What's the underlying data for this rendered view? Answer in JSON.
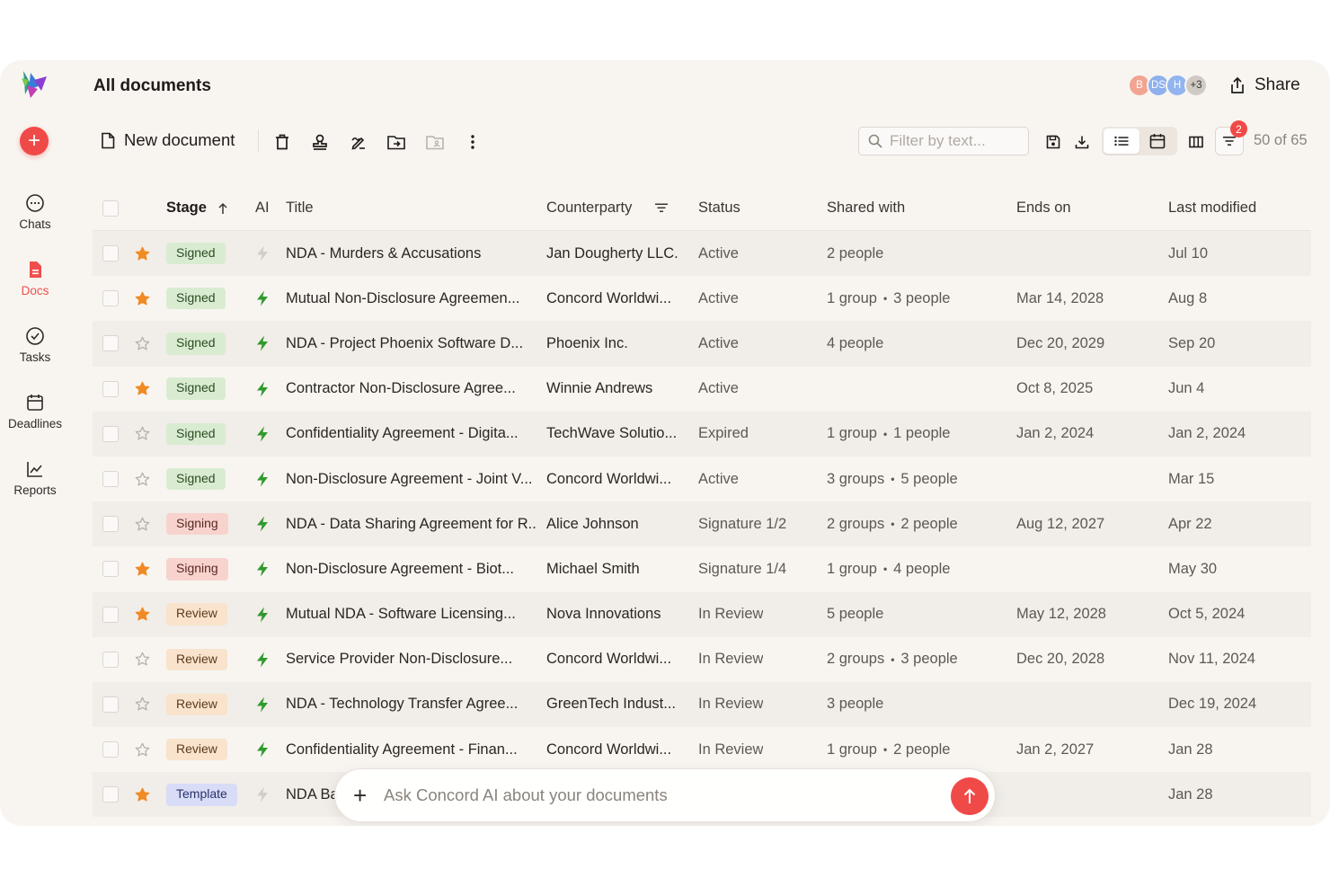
{
  "colors": {
    "accent": "#f04a48",
    "background": "#f8f5f1",
    "bolt_active": "#2f9a2c",
    "star": "#f08a24"
  },
  "sidebar": {
    "new_icon": "plus-icon",
    "items": [
      {
        "label": "Chats",
        "icon": "chat-bubble-icon",
        "active": false
      },
      {
        "label": "Docs",
        "icon": "document-icon",
        "active": true
      },
      {
        "label": "Tasks",
        "icon": "check-circle-icon",
        "active": false
      },
      {
        "label": "Deadlines",
        "icon": "calendar-icon",
        "active": false
      },
      {
        "label": "Reports",
        "icon": "line-chart-icon",
        "active": false
      }
    ]
  },
  "header": {
    "title": "All documents",
    "avatars": [
      {
        "initials": "B",
        "color": "#f2a493"
      },
      {
        "initials": "DS",
        "color": "#8fb0ec"
      },
      {
        "initials": "H",
        "color": "#92b4ef"
      },
      {
        "initials": "+3",
        "color": "#cfcac4"
      }
    ],
    "share_label": "Share"
  },
  "toolbar": {
    "new_document_label": "New document",
    "filter_placeholder": "Filter by text...",
    "filter_count": "2",
    "result_count": "50 of 65"
  },
  "table": {
    "columns": {
      "stage": "Stage",
      "ai": "AI",
      "title": "Title",
      "counterparty": "Counterparty",
      "status": "Status",
      "shared_with": "Shared with",
      "ends_on": "Ends on",
      "last_modified": "Last modified"
    },
    "rows": [
      {
        "starred": true,
        "stage": "Signed",
        "ai": false,
        "title": "NDA - Murders & Accusations",
        "counterparty": "Jan Dougherty LLC.",
        "status": "Active",
        "shared": [
          "2 people"
        ],
        "ends_on": "",
        "modified": "Jul 10"
      },
      {
        "starred": true,
        "stage": "Signed",
        "ai": true,
        "title": "Mutual Non-Disclosure Agreemen...",
        "counterparty": "Concord Worldwi...",
        "status": "Active",
        "shared": [
          "1 group",
          "3 people"
        ],
        "ends_on": "Mar 14, 2028",
        "modified": "Aug 8"
      },
      {
        "starred": false,
        "stage": "Signed",
        "ai": true,
        "title": "NDA - Project Phoenix Software D...",
        "counterparty": "Phoenix Inc.",
        "status": "Active",
        "shared": [
          "4 people"
        ],
        "ends_on": "Dec 20, 2029",
        "modified": "Sep 20"
      },
      {
        "starred": true,
        "stage": "Signed",
        "ai": true,
        "title": "Contractor Non-Disclosure Agree...",
        "counterparty": "Winnie Andrews",
        "status": "Active",
        "shared": [],
        "ends_on": "Oct 8, 2025",
        "modified": "Jun 4"
      },
      {
        "starred": false,
        "stage": "Signed",
        "ai": true,
        "title": "Confidentiality Agreement - Digita...",
        "counterparty": "TechWave Solutio...",
        "status": "Expired",
        "shared": [
          "1 group",
          "1 people"
        ],
        "ends_on": "Jan 2, 2024",
        "modified": "Jan 2, 2024"
      },
      {
        "starred": false,
        "stage": "Signed",
        "ai": true,
        "title": "Non-Disclosure Agreement - Joint V...",
        "counterparty": "Concord Worldwi...",
        "status": "Active",
        "shared": [
          "3 groups",
          "5 people"
        ],
        "ends_on": "",
        "modified": "Mar 15"
      },
      {
        "starred": false,
        "stage": "Signing",
        "ai": true,
        "title": "NDA - Data Sharing Agreement for R...",
        "counterparty": "Alice Johnson",
        "status": "Signature 1/2",
        "shared": [
          "2 groups",
          "2 people"
        ],
        "ends_on": "Aug 12, 2027",
        "modified": "Apr 22"
      },
      {
        "starred": true,
        "stage": "Signing",
        "ai": true,
        "title": "Non-Disclosure Agreement - Biot...",
        "counterparty": "Michael Smith",
        "status": "Signature 1/4",
        "shared": [
          "1 group",
          "4 people"
        ],
        "ends_on": "",
        "modified": "May 30"
      },
      {
        "starred": true,
        "stage": "Review",
        "ai": true,
        "title": "Mutual NDA - Software Licensing...",
        "counterparty": "Nova Innovations",
        "status": "In Review",
        "shared": [
          "5 people"
        ],
        "ends_on": "May 12, 2028",
        "modified": "Oct 5, 2024"
      },
      {
        "starred": false,
        "stage": "Review",
        "ai": true,
        "title": "Service Provider Non-Disclosure...",
        "counterparty": "Concord Worldwi...",
        "status": "In Review",
        "shared": [
          "2 groups",
          "3 people"
        ],
        "ends_on": "Dec 20, 2028",
        "modified": "Nov 11, 2024"
      },
      {
        "starred": false,
        "stage": "Review",
        "ai": true,
        "title": "NDA - Technology Transfer Agree...",
        "counterparty": "GreenTech Indust...",
        "status": "In Review",
        "shared": [
          "3 people"
        ],
        "ends_on": "",
        "modified": "Dec 19, 2024"
      },
      {
        "starred": false,
        "stage": "Review",
        "ai": true,
        "title": "Confidentiality Agreement - Finan...",
        "counterparty": "Concord Worldwi...",
        "status": "In Review",
        "shared": [
          "1 group",
          "2 people"
        ],
        "ends_on": "Jan 2, 2027",
        "modified": "Jan 28"
      },
      {
        "starred": true,
        "stage": "Template",
        "ai": false,
        "title": "NDA Ba",
        "counterparty": "",
        "status": "",
        "shared": [],
        "ends_on": "",
        "modified": "Jan 28"
      }
    ]
  },
  "chat": {
    "placeholder": "Ask Concord AI about your documents",
    "plus_label": "+"
  }
}
